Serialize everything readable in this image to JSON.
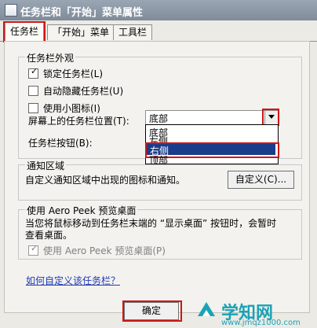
{
  "window": {
    "title": "任务栏和「开始」菜单属性"
  },
  "tabs": [
    {
      "label": "任务栏"
    },
    {
      "label": "「开始」菜单"
    },
    {
      "label": "工具栏"
    }
  ],
  "taskbar_appearance": {
    "title": "任务栏外观",
    "options": [
      {
        "label": "锁定任务栏(L)",
        "checked": true
      },
      {
        "label": "自动隐藏任务栏(U)",
        "checked": false
      },
      {
        "label": "使用小图标(I)",
        "checked": false
      }
    ],
    "position_label": "屏幕上的任务栏位置(T):",
    "position_value": "底部",
    "position_options": [
      "底部",
      "左侧",
      "右侧",
      "顶部"
    ],
    "selected_option_index": 2,
    "buttons_label": "任务栏按钮(B):"
  },
  "notification_area": {
    "title": "通知区域",
    "description": "自定义通知区域中出现的图标和通知。",
    "customize_button": "自定义(C)..."
  },
  "aero_peek": {
    "title": "使用 Aero Peek 预览桌面",
    "description_line1": "当您将鼠标移动到任务栏末端的 “显示桌面” 按钮时，会暂时",
    "description_line2": "查看桌面。",
    "checkbox_label": "使用 Aero Peek 预览桌面(P)",
    "checked": true,
    "disabled": true
  },
  "help_link": "如何自定义该任务栏？",
  "footer": {
    "ok_button": "确定"
  },
  "watermark": {
    "brand": "学知网",
    "url": "www.jmqz1000.com"
  },
  "colors": {
    "highlight": "#d21414",
    "selection": "#1a3d8a",
    "link": "#1f39b8",
    "watermark": "#1aa3b6"
  }
}
